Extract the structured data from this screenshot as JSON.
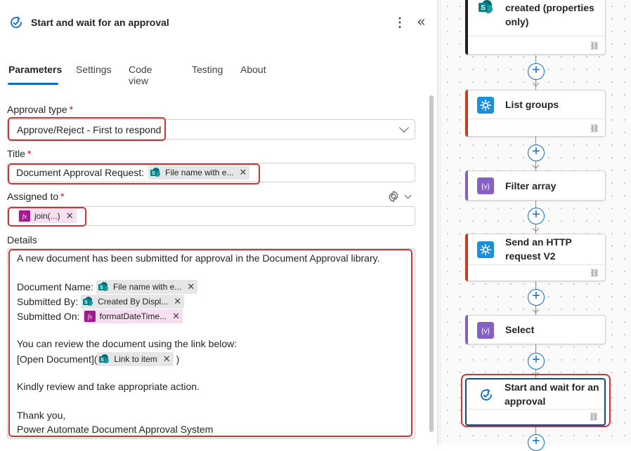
{
  "panel": {
    "title": "Start and wait for an approval",
    "more_icon": "more-vertical-icon",
    "collapse_icon": "collapse-panel-icon",
    "tabs": [
      {
        "label": "Parameters",
        "active": true
      },
      {
        "label": "Settings",
        "active": false
      },
      {
        "label": "Code view",
        "active": false
      },
      {
        "label": "Testing",
        "active": false
      },
      {
        "label": "About",
        "active": false
      }
    ],
    "approval_type": {
      "label": "Approval type",
      "required": "*",
      "value": "Approve/Reject - First to respond"
    },
    "title_field": {
      "label": "Title",
      "required": "*",
      "prefix": "Document Approval Request:",
      "token": "File name with e..."
    },
    "assigned_to": {
      "label": "Assigned to",
      "required": "*",
      "token": "join(...)"
    },
    "details": {
      "label": "Details",
      "line1": "A new document has been submitted for approval in the Document Approval library.",
      "doc_name_label": "Document Name:",
      "doc_name_token": "File name with e...",
      "submitted_by_label": "Submitted By:",
      "submitted_by_token": "Created By Displ...",
      "submitted_on_label": "Submitted On:",
      "submitted_on_token": "formatDateTime...",
      "review_line": "You can review the document using the link below:",
      "link_prefix": "[Open Document](",
      "link_token": "Link to item",
      "link_suffix": ")",
      "kindly": "Kindly review and take appropriate action.",
      "thanks": "Thank you,",
      "signature": "Power Automate Document Approval System"
    }
  },
  "flow": {
    "cards": [
      {
        "title": "When a file is created (properties only)",
        "icon": "sharepoint-icon",
        "bar_color": "#1f1f1f"
      },
      {
        "title": "List groups",
        "icon": "http-webhook-icon",
        "bar_color": "#c43e1c"
      },
      {
        "title": "Filter array",
        "icon": "data-operation-icon",
        "bar_color": "#8661c5"
      },
      {
        "title": "Send an HTTP request V2",
        "icon": "http-webhook-icon",
        "bar_color": "#c43e1c"
      },
      {
        "title": "Select",
        "icon": "data-operation-icon",
        "bar_color": "#8661c5"
      },
      {
        "title": "Start and wait for an approval",
        "icon": "approval-icon",
        "bar_color": "#0f4a8a"
      }
    ]
  },
  "colors": {
    "accent": "#0f6cbd",
    "highlight": "#d13438",
    "sharepoint": "#038387",
    "expression": "#a01c8c"
  }
}
